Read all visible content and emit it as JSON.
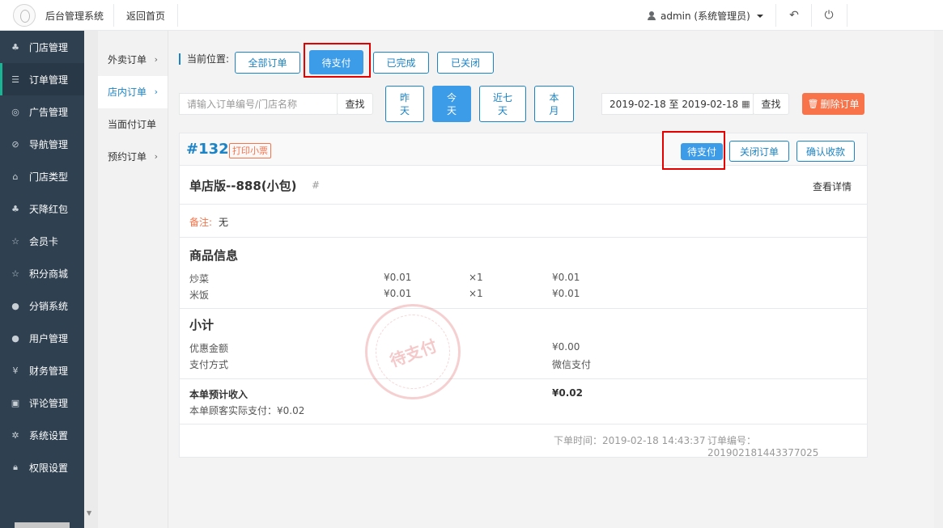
{
  "topbar": {
    "app_title": "后台管理系统",
    "back_home": "返回首页",
    "user": "admin (系统管理员)"
  },
  "sidebar": {
    "items": [
      {
        "label": "门店管理",
        "icon": "group-icon"
      },
      {
        "label": "订单管理",
        "icon": "list-icon"
      },
      {
        "label": "广告管理",
        "icon": "lifebuoy-icon"
      },
      {
        "label": "导航管理",
        "icon": "compass-icon"
      },
      {
        "label": "门店类型",
        "icon": "bank-icon"
      },
      {
        "label": "天降红包",
        "icon": "group-icon"
      },
      {
        "label": "会员卡",
        "icon": "star-icon"
      },
      {
        "label": "积分商城",
        "icon": "star-icon"
      },
      {
        "label": "分销系统",
        "icon": "users-icon"
      },
      {
        "label": "用户管理",
        "icon": "user-icon"
      },
      {
        "label": "财务管理",
        "icon": "yen-icon"
      },
      {
        "label": "评论管理",
        "icon": "money-icon"
      },
      {
        "label": "系统设置",
        "icon": "gear-icon"
      },
      {
        "label": "权限设置",
        "icon": "lock-icon"
      }
    ]
  },
  "subnav": {
    "items": [
      {
        "label": "外卖订单",
        "arrow": "›"
      },
      {
        "label": "店内订单",
        "arrow": "›"
      },
      {
        "label": "当面付订单",
        "arrow": ""
      },
      {
        "label": "预约订单",
        "arrow": "›"
      }
    ]
  },
  "crumb": {
    "label": "当前位置:",
    "tabs": [
      "全部订单",
      "待支付",
      "已完成",
      "已关闭"
    ]
  },
  "filter": {
    "search_placeholder": "请输入订单编号/门店名称",
    "search_btn": "查找",
    "date_btns": [
      "昨\n天",
      "今\n天",
      "近七\n天",
      "本\n月"
    ],
    "date_range": "2019-02-18 至 2019-02-18",
    "date_search_btn": "查找",
    "delete_btn": "删除订单"
  },
  "order": {
    "number": "#132",
    "print_label": "打印小票",
    "status_btn": "待支付",
    "close_btn": "关闭订单",
    "confirm_btn": "确认收款",
    "store_title": "单店版--888(小包)",
    "hash": "#",
    "detail_link": "查看详情",
    "note_label": "备注:",
    "note_value": "无",
    "goods_heading": "商品信息",
    "goods": [
      {
        "name": "炒菜",
        "price": "¥0.01",
        "qty": "×1",
        "total": "¥0.01"
      },
      {
        "name": "米饭",
        "price": "¥0.01",
        "qty": "×1",
        "total": "¥0.01"
      }
    ],
    "subtotal_heading": "小计",
    "discount_label": "优惠金额",
    "discount_value": "¥0.00",
    "pay_label": "支付方式",
    "pay_value": "微信支付",
    "income_label": "本单预计收入",
    "income_value": "¥0.02",
    "actual_pay": "本单顾客实际支付：¥0.02",
    "order_time": "下单时间：2019-02-18 14:43:37",
    "order_code": "订单编号：201902181443377025",
    "stamp": "待支付"
  }
}
